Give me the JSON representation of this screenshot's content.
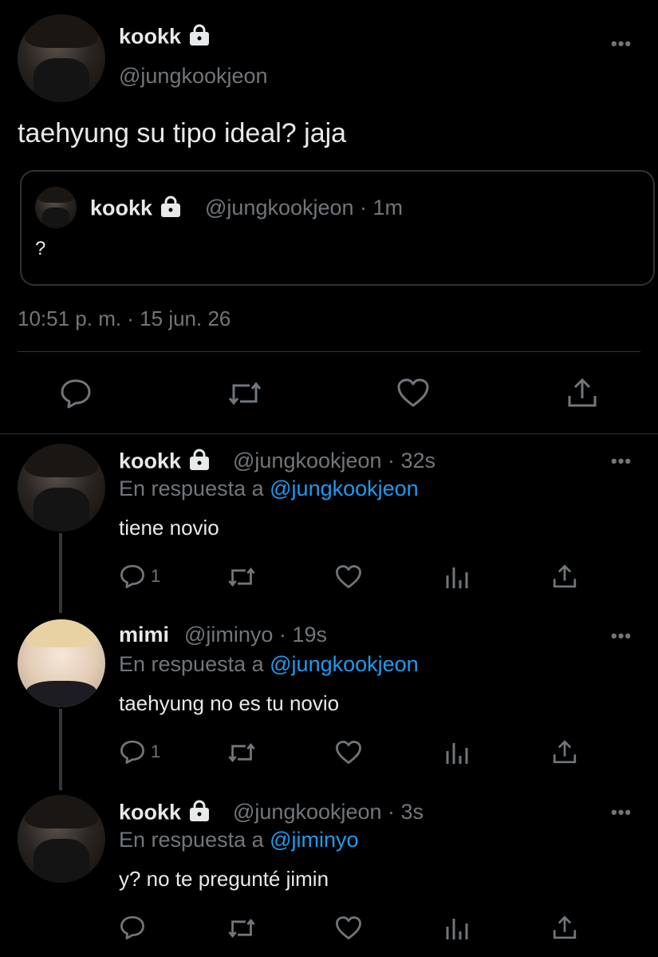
{
  "main_tweet": {
    "name": "kookk",
    "handle": "@jungkookjeon",
    "more": "•••",
    "text": "taehyung su tipo ideal? jaja",
    "quote": {
      "name": "kookk",
      "handle_time": "@jungkookjeon · 1m",
      "text": "?"
    },
    "timestamp": "10:51 p. m. · 15 jun. 26"
  },
  "replies": [
    {
      "name": "kookk",
      "handle_time": "@jungkookjeon · 32s",
      "reply_prefix": "En respuesta a",
      "reply_to": "@jungkookjeon",
      "text": "tiene novio",
      "reply_count": "1",
      "more": "•••"
    },
    {
      "name": "mimi",
      "handle_time": "@jiminyo · 19s",
      "reply_prefix": "En respuesta a",
      "reply_to": "@jungkookjeon",
      "text": "taehyung no es tu novio",
      "reply_count": "1",
      "more": "•••"
    },
    {
      "name": "kookk",
      "handle_time": "@jungkookjeon · 3s",
      "reply_prefix": "En respuesta a",
      "reply_to": "@jiminyo",
      "text": "y? no te pregunté jimin",
      "reply_count": "",
      "more": "•••"
    }
  ],
  "icons": {
    "reply": "reply-icon",
    "retweet": "retweet-icon",
    "like": "heart-icon",
    "analytics": "analytics-icon",
    "share": "share-icon",
    "lock": "lock-icon",
    "more": "more-icon"
  },
  "colors": {
    "background": "#000000",
    "text": "#e7e9ea",
    "muted": "#71767b",
    "link": "#1d9bf0",
    "border": "#2f3336"
  }
}
